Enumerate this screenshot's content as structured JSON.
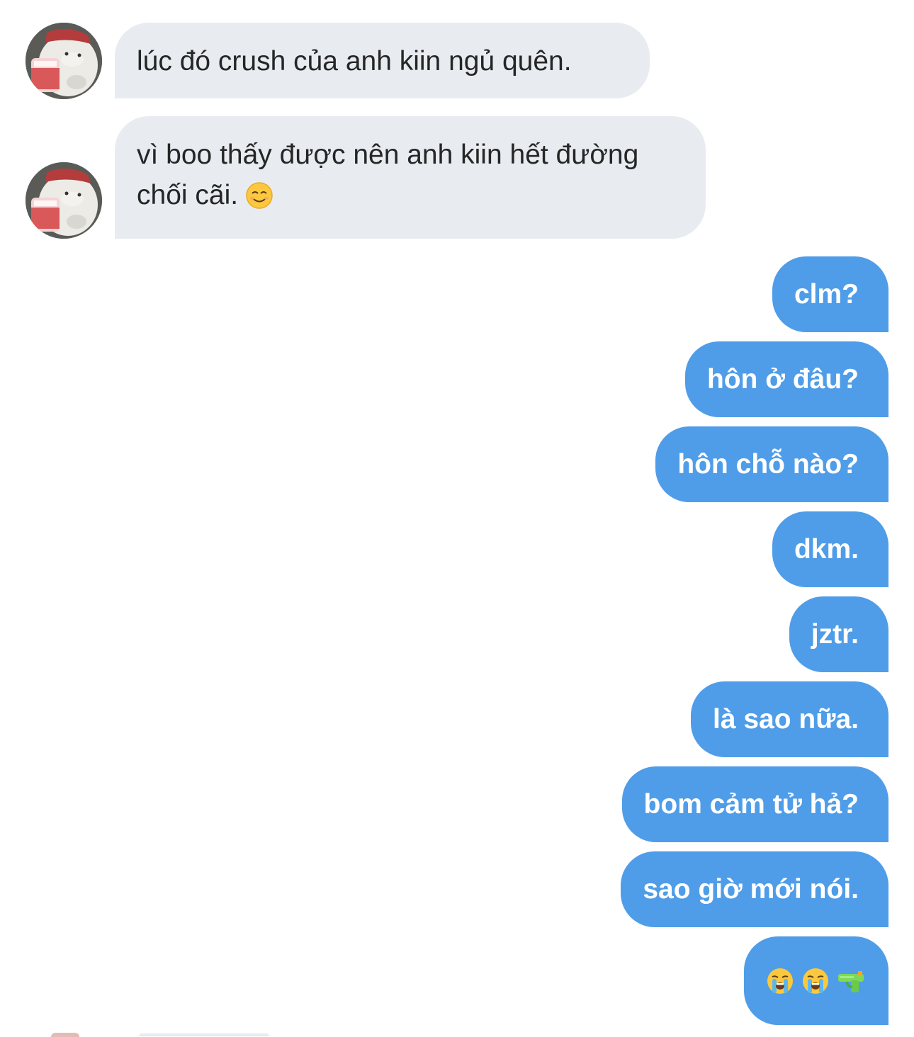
{
  "thread": {
    "incoming": [
      {
        "text": "lúc đó crush của anh kiin ngủ quên."
      },
      {
        "text": "vì boo thấy được nên anh kiin hết đường chối cãi.",
        "emoji": "smiling-face-emoji"
      }
    ],
    "outgoing": [
      {
        "text": "clm?"
      },
      {
        "text": "hôn ở đâu?"
      },
      {
        "text": "hôn chỗ nào?"
      },
      {
        "text": "dkm."
      },
      {
        "text": "jztr."
      },
      {
        "text": "là sao nữa."
      },
      {
        "text": "bom cảm tử hả?"
      },
      {
        "text": "sao giờ mới nói."
      },
      {
        "text": "",
        "emojis": [
          "loudly-crying-face-emoji",
          "loudly-crying-face-emoji",
          "water-pistol-emoji"
        ]
      }
    ]
  },
  "avatar": {
    "icon": "bear-avatar-icon"
  },
  "colors": {
    "incoming_bubble": "#e8ecf0",
    "incoming_text": "#262626",
    "outgoing_bubble": "#4f9de8",
    "outgoing_text": "#ffffff",
    "background": "#ffffff"
  }
}
